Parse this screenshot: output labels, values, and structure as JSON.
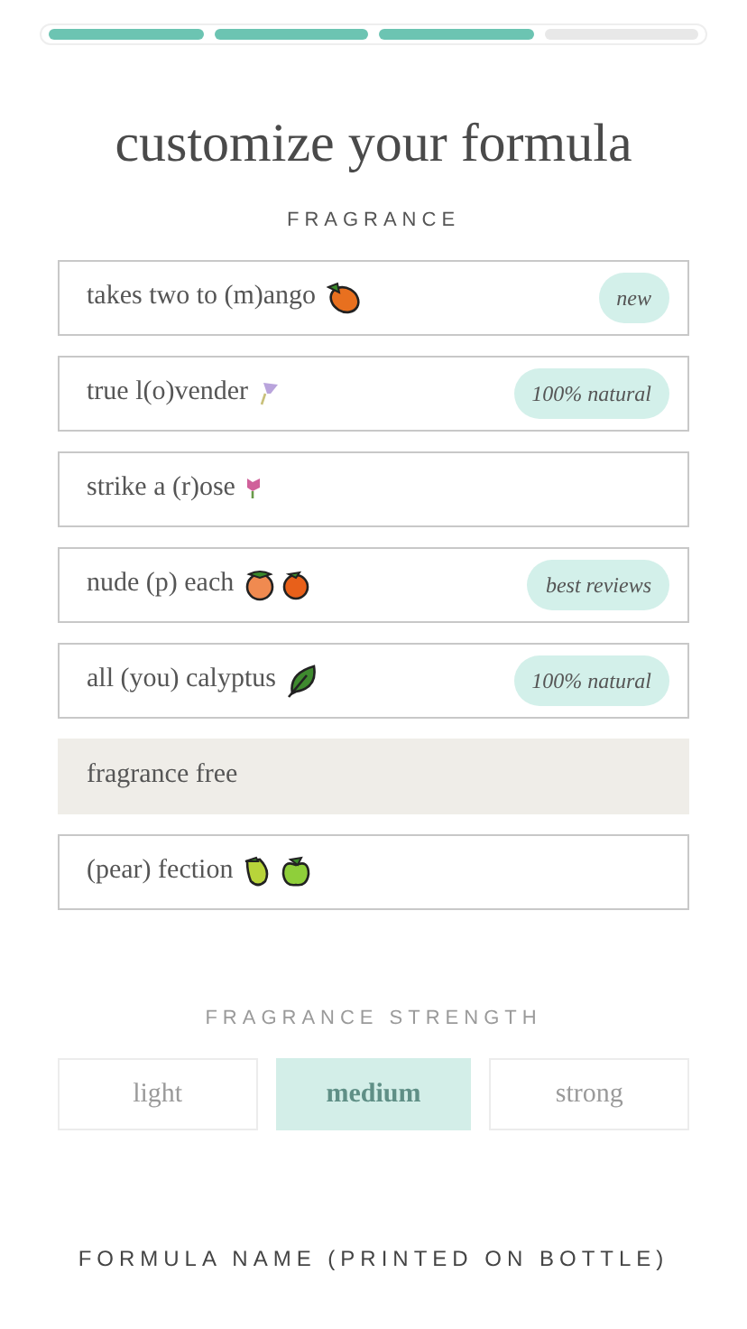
{
  "progress": [
    {
      "done": true
    },
    {
      "done": true
    },
    {
      "done": true
    },
    {
      "done": false
    }
  ],
  "title": "customize your formula",
  "fragrance": {
    "label": "FRAGRANCE",
    "options": [
      {
        "name": "takes two to (m)ango",
        "badge": "new",
        "selected": false
      },
      {
        "name": "true l(o)vender",
        "badge": "100% natural",
        "selected": false
      },
      {
        "name": "strike a (r)ose",
        "selected": false
      },
      {
        "name": "nude (p) each",
        "badge": "best reviews",
        "selected": false
      },
      {
        "name": "all (you) calyptus",
        "badge": "100% natural",
        "selected": false
      },
      {
        "name": "fragrance free",
        "selected": true
      },
      {
        "name": "(pear) fection",
        "selected": false
      }
    ]
  },
  "strength": {
    "label": "FRAGRANCE STRENGTH",
    "disabled": true,
    "options": [
      {
        "label": "light",
        "selected": false
      },
      {
        "label": "medium",
        "selected": true
      },
      {
        "label": "strong",
        "selected": false
      }
    ]
  },
  "formula_name": {
    "label": "FORMULA NAME (PRINTED ON BOTTLE)"
  }
}
